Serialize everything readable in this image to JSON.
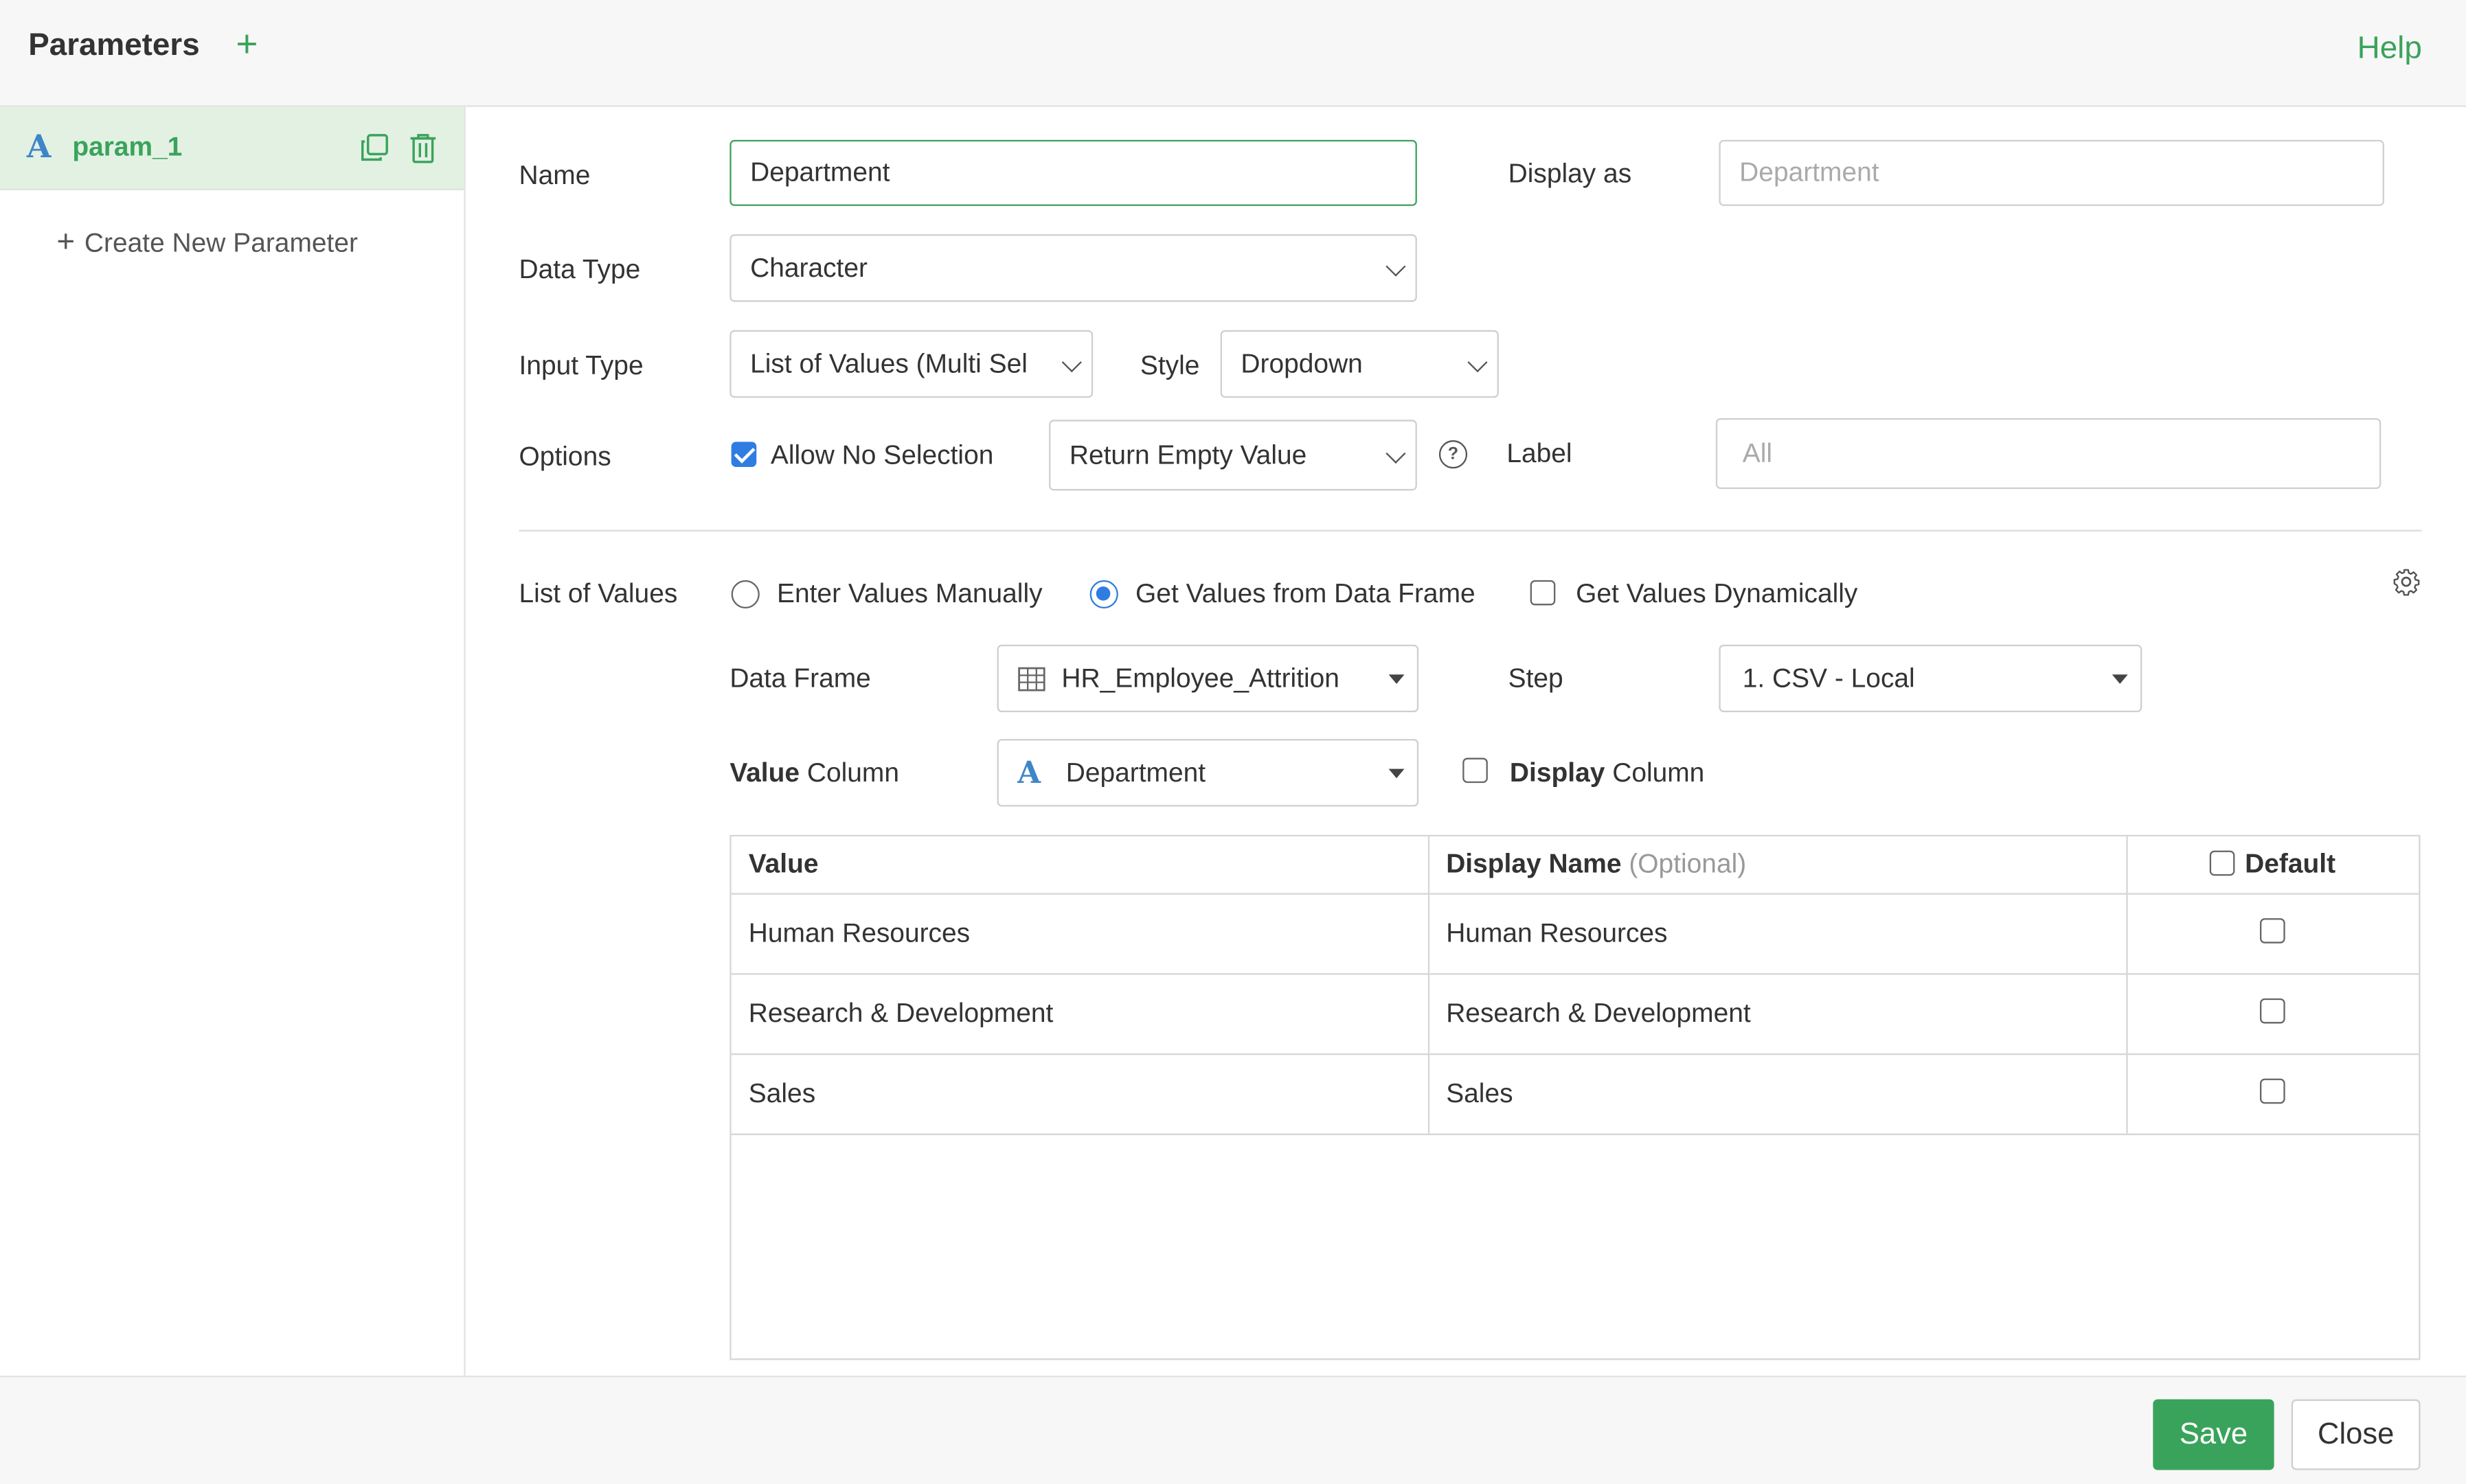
{
  "header": {
    "title": "Parameters",
    "add_symbol": "+",
    "help": "Help"
  },
  "sidebar": {
    "param": {
      "type_icon": "A",
      "name": "param_1"
    },
    "create_new": "Create New Parameter"
  },
  "form": {
    "name_label": "Name",
    "name_value": "Department",
    "display_as_label": "Display as",
    "display_as_placeholder": "Department",
    "data_type_label": "Data Type",
    "data_type_value": "Character",
    "input_type_label": "Input Type",
    "input_type_value": "List of Values (Multi Sel",
    "style_label": "Style",
    "style_value": "Dropdown",
    "options_label": "Options",
    "allow_no_selection": {
      "label": "Allow No Selection",
      "checked": true
    },
    "return_value": "Return Empty Value",
    "label_label": "Label",
    "label_placeholder": "All"
  },
  "list_of_values": {
    "label": "List of Values",
    "radio_manual": "Enter Values Manually",
    "radio_data_frame": "Get Values from Data Frame",
    "check_dynamic": "Get Values Dynamically",
    "data_frame_label": "Data Frame",
    "data_frame_value": "HR_Employee_Attrition",
    "step_label": "Step",
    "step_value": "1. CSV - Local",
    "value_column_label_bold": "Value",
    "value_column_label_rest": " Column",
    "value_column_icon": "A",
    "value_column_value": "Department",
    "display_column_label_bold": "Display",
    "display_column_label_rest": " Column"
  },
  "table": {
    "headers": {
      "value": "Value",
      "display_name": "Display Name",
      "display_name_optional": "(Optional)",
      "default": "Default"
    },
    "rows": [
      {
        "value": "Human Resources",
        "display": "Human Resources"
      },
      {
        "value": "Research & Development",
        "display": "Research & Development"
      },
      {
        "value": "Sales",
        "display": "Sales"
      }
    ]
  },
  "footer": {
    "save": "Save",
    "close": "Close"
  },
  "colors": {
    "accent_green": "#3aa35b",
    "selected_blue": "#2f7de1",
    "selected_row": "#e3f1e3"
  }
}
